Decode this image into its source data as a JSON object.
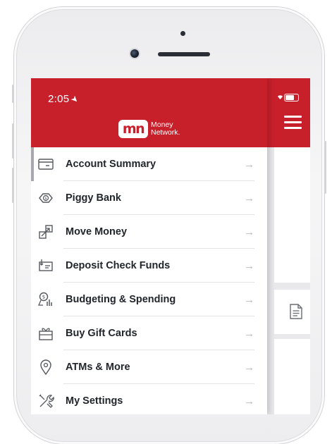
{
  "status_bar": {
    "time": "2:05"
  },
  "brand": {
    "logo_mark": "mn",
    "name_line1": "Money",
    "name_line2": "Network."
  },
  "menu": {
    "items": [
      {
        "label": "Account Summary",
        "icon": "account-summary-icon",
        "active": true
      },
      {
        "label": "Piggy Bank",
        "icon": "piggy-bank-icon"
      },
      {
        "label": "Move Money",
        "icon": "move-money-icon"
      },
      {
        "label": "Deposit Check Funds",
        "icon": "deposit-check-icon"
      },
      {
        "label": "Budgeting & Spending",
        "icon": "budgeting-icon"
      },
      {
        "label": "Buy Gift Cards",
        "icon": "gift-card-icon"
      },
      {
        "label": "ATMs & More",
        "icon": "location-pin-icon"
      },
      {
        "label": "My Settings",
        "icon": "settings-tools-icon"
      }
    ],
    "arrow": "→"
  },
  "colors": {
    "brand_red": "#c8202b",
    "text": "#22252b",
    "icon": "#55585f",
    "arrow": "#b3b3b8"
  }
}
